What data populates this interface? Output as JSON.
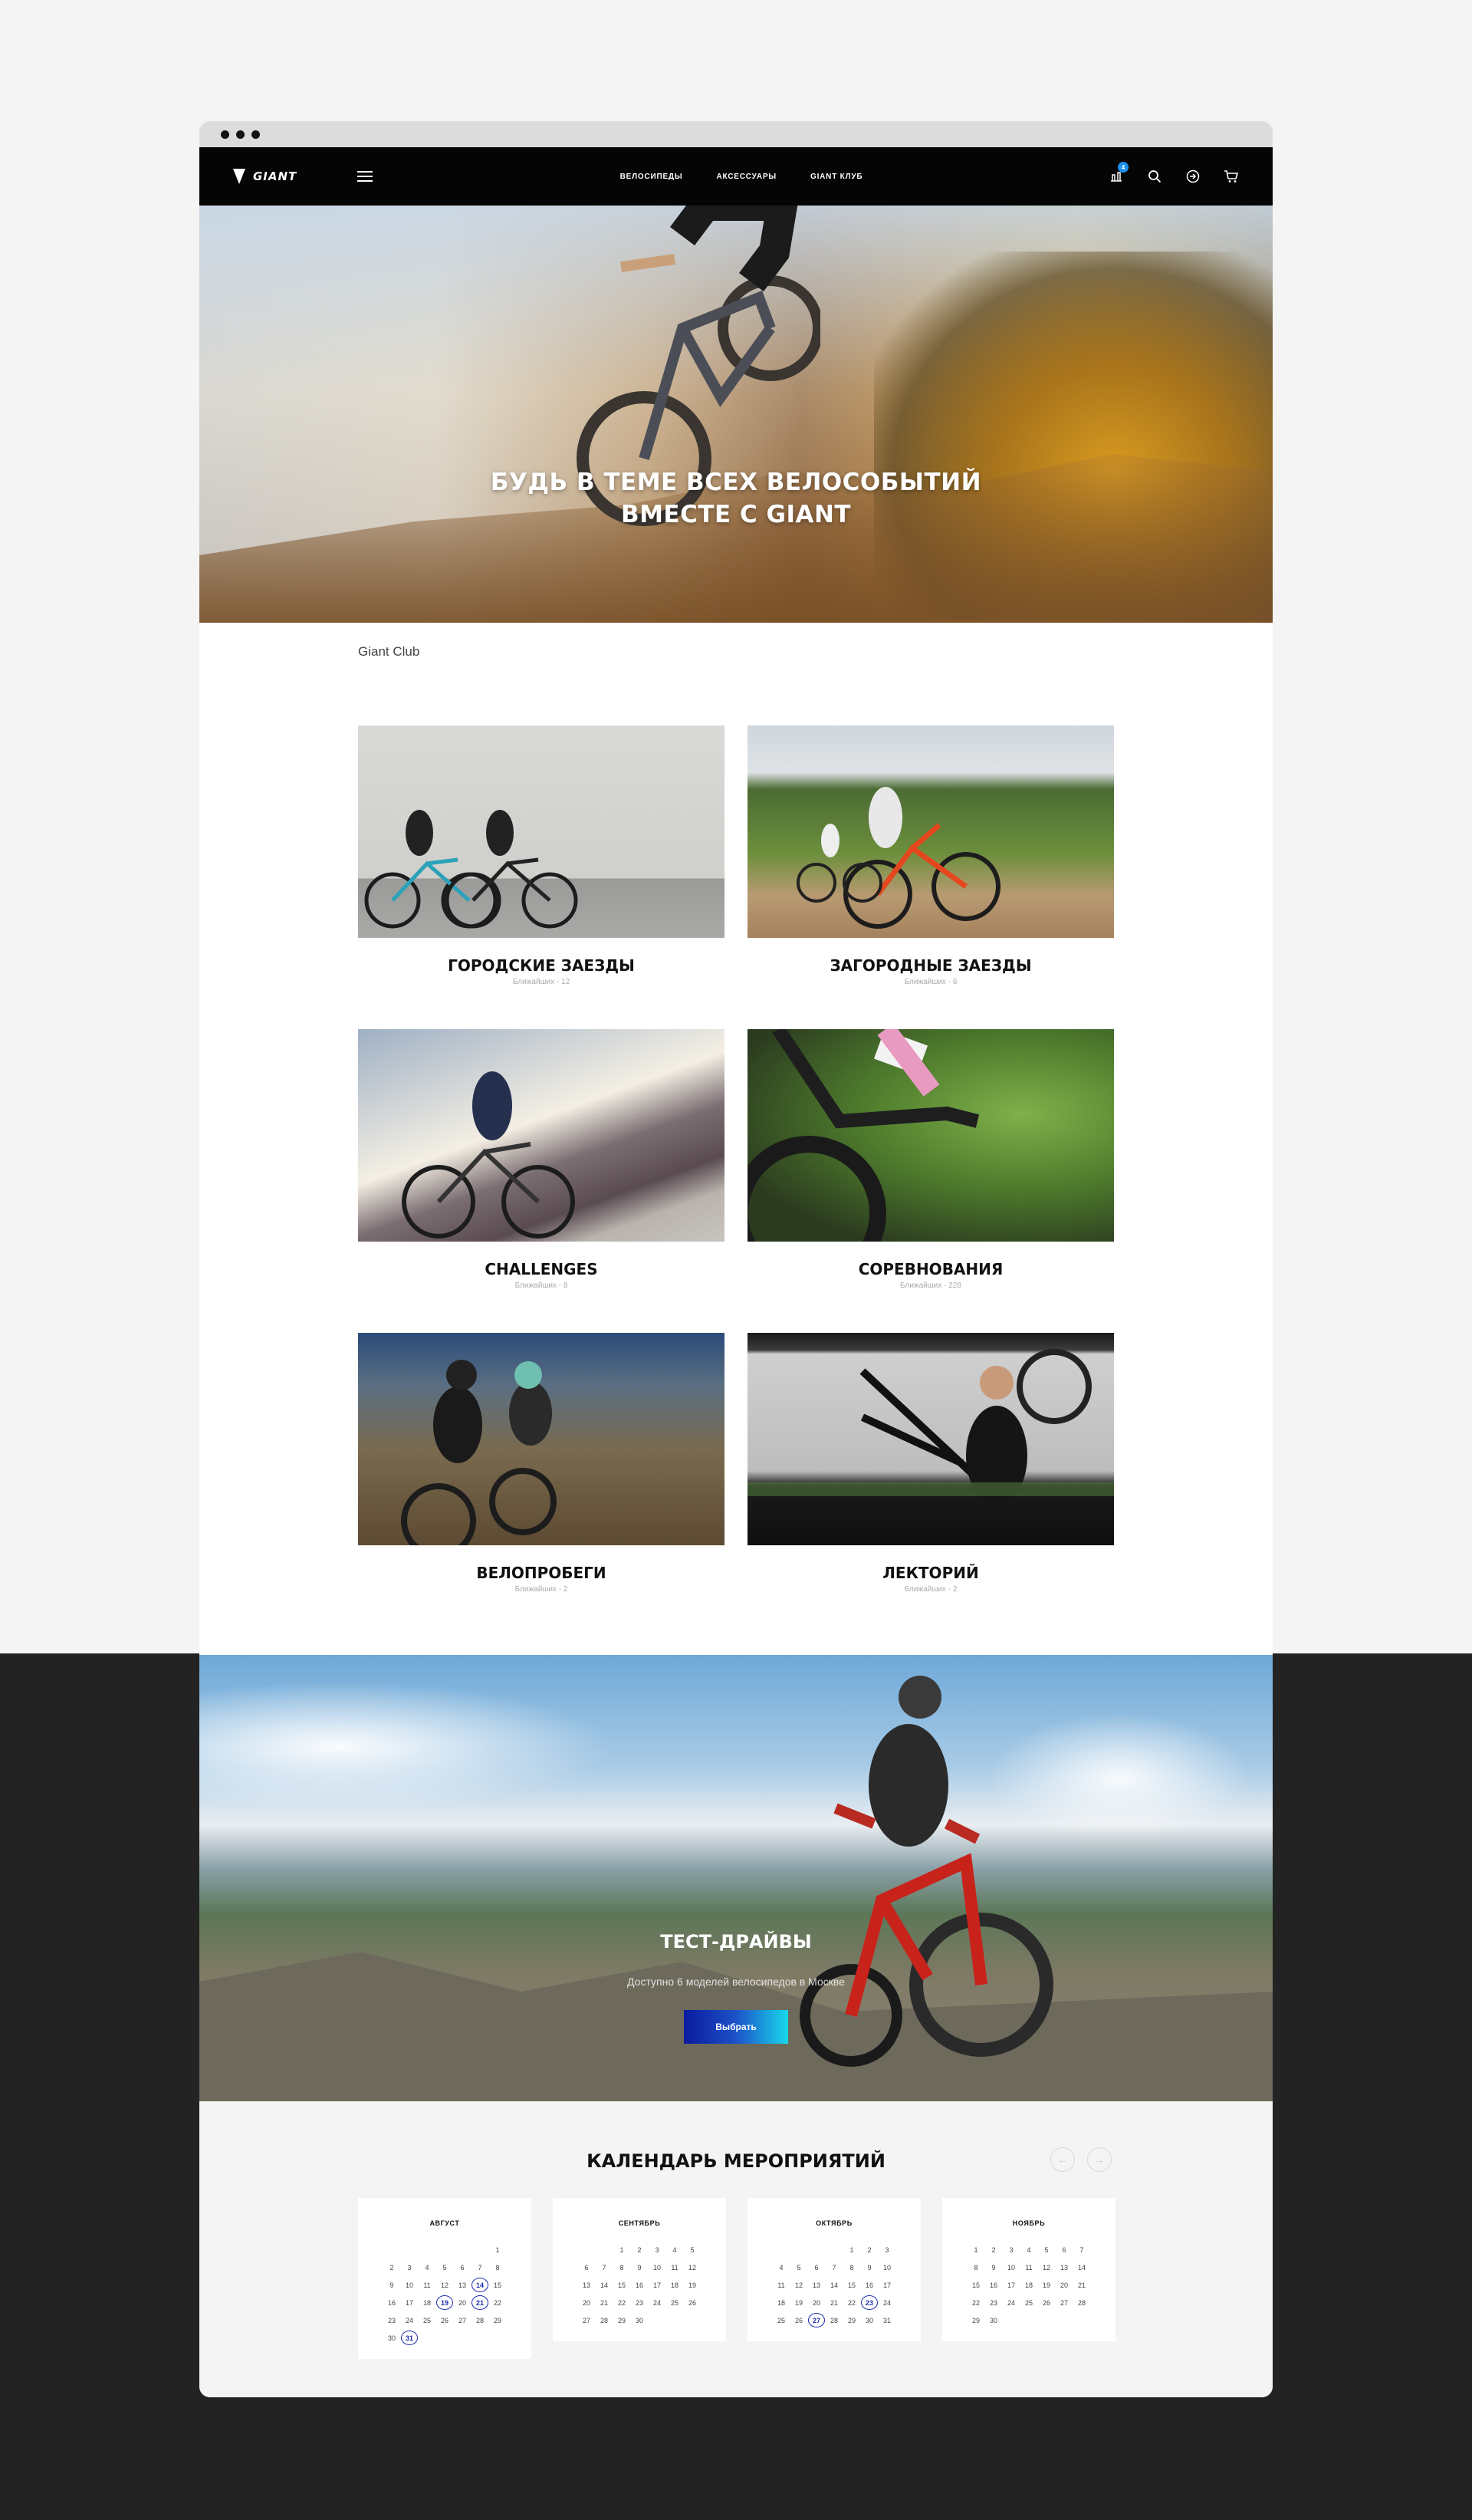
{
  "header": {
    "nav": [
      "ВЕЛОСИПЕДЫ",
      "АКСЕССУАРЫ",
      "GIANT КЛУБ"
    ],
    "compare_badge": "4"
  },
  "hero": {
    "title_line1": "БУДЬ В ТЕМЕ ВСЕХ ВЕЛОСОБЫТИЙ",
    "title_line2": "ВМЕСТЕ С GIANT"
  },
  "breadcrumb": "Giant Club",
  "cards": [
    {
      "title": "ГОРОДСКИЕ ЗАЕЗДЫ",
      "meta": "Ближайших - 12"
    },
    {
      "title": "ЗАГОРОДНЫЕ ЗАЕЗДЫ",
      "meta": "Ближайших - 6"
    },
    {
      "title": "CHALLENGES",
      "meta": "Ближайших - 8"
    },
    {
      "title": "СОРЕВНОВАНИЯ",
      "meta": "Ближайших - 228"
    },
    {
      "title": "ВЕЛОПРОБЕГИ",
      "meta": "Ближайших - 2"
    },
    {
      "title": "ЛЕКТОРИЙ",
      "meta": "Ближайших - 2"
    }
  ],
  "test_drive": {
    "title": "ТЕСТ-ДРАЙВЫ",
    "subtitle": "Доступно 6 моделей велосипедов в Москве",
    "button": "Выбрать"
  },
  "calendar": {
    "title": "КАЛЕНДАРЬ МЕРОПРИЯТИЙ",
    "prev": "←",
    "next": "→",
    "months": [
      {
        "name": "АВГУСТ",
        "offset": 6,
        "days": 31,
        "events": [
          14,
          19,
          21,
          31
        ]
      },
      {
        "name": "СЕНТЯБРЬ",
        "offset": 2,
        "days": 30,
        "events": []
      },
      {
        "name": "ОКТЯБРЬ",
        "offset": 4,
        "days": 31,
        "events": [
          23,
          27
        ]
      },
      {
        "name": "НОЯБРЬ",
        "offset": 0,
        "days": 30,
        "events": []
      }
    ]
  },
  "colors": {
    "accent": "#1a2bb0",
    "badge": "#1b8ff0",
    "header_bg": "#050505"
  }
}
